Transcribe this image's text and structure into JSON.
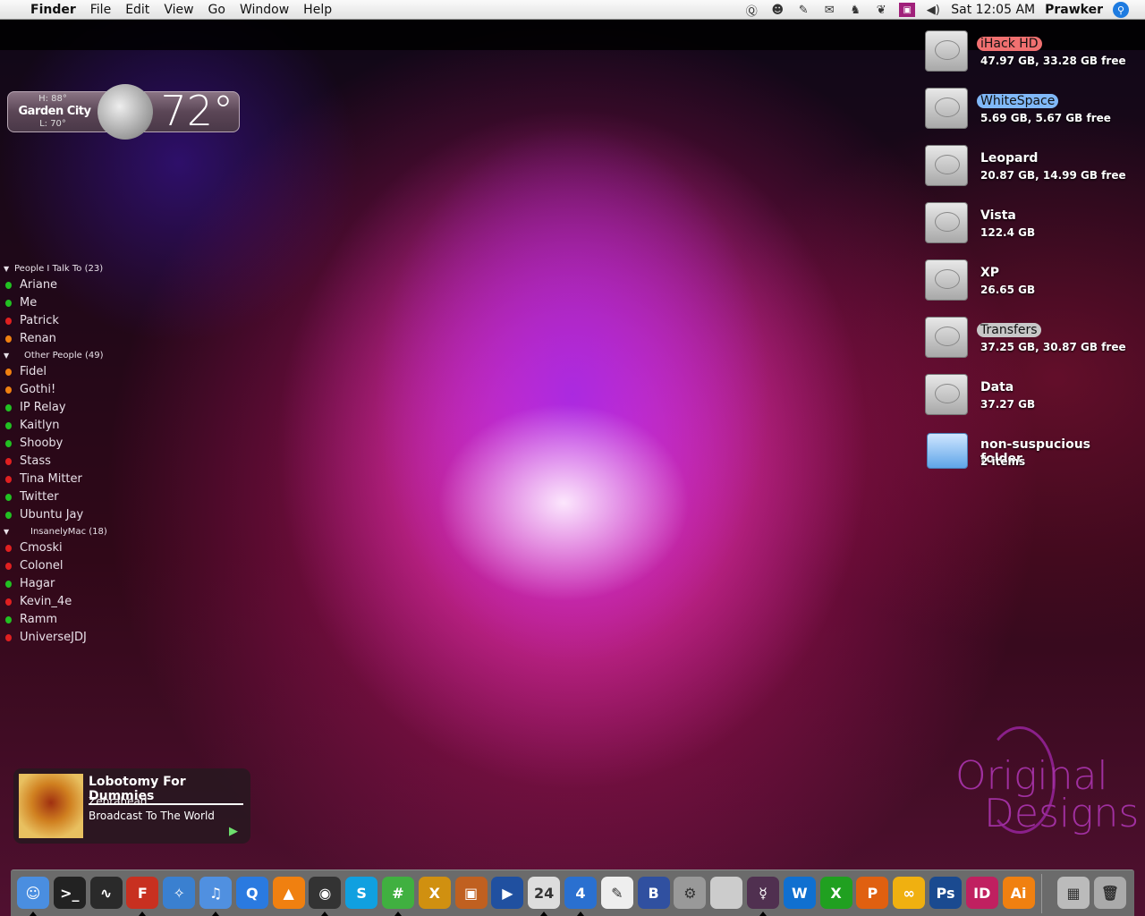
{
  "menubar": {
    "apple": "",
    "app": "Finder",
    "menus": [
      "File",
      "Edit",
      "View",
      "Go",
      "Window",
      "Help"
    ],
    "status_icons": [
      "quicksilver-icon",
      "adium-duck-icon",
      "growl-speech-icon",
      "mail-icon",
      "bird-icon",
      "paw-icon",
      "monitor-face-icon",
      "volume-icon"
    ],
    "clock": "Sat 12:05 AM",
    "user": "Prawker"
  },
  "weather": {
    "high": "H: 88°",
    "city": "Garden City",
    "low": "L: 70°",
    "temp": "72°"
  },
  "buddy_list": {
    "groups": [
      {
        "name": "People I Talk To (23)",
        "buddies": [
          {
            "name": "Ariane",
            "status": "green"
          },
          {
            "name": "Me ",
            "status": "green"
          },
          {
            "name": "Patrick",
            "status": "red"
          },
          {
            "name": "Renan",
            "status": "orange"
          }
        ]
      },
      {
        "name": "Other People (49)",
        "buddies": [
          {
            "name": "Fidel",
            "status": "orange"
          },
          {
            "name": "Gothi!",
            "status": "orange"
          },
          {
            "name": "IP Relay",
            "status": "green"
          },
          {
            "name": "Kaitlyn",
            "status": "green"
          },
          {
            "name": "Shooby",
            "status": "green"
          },
          {
            "name": "Stass",
            "status": "red"
          },
          {
            "name": "Tina Mitter",
            "status": "red"
          },
          {
            "name": "Twitter",
            "status": "green"
          },
          {
            "name": "Ubuntu Jay",
            "status": "green"
          }
        ]
      },
      {
        "name": "InsanelyMac (18)",
        "buddies": [
          {
            "name": "Cmoski",
            "status": "red"
          },
          {
            "name": "Colonel",
            "status": "red"
          },
          {
            "name": "Hagar",
            "status": "green"
          },
          {
            "name": "Kevin_4e",
            "status": "red"
          },
          {
            "name": "Ramm",
            "status": "green"
          },
          {
            "name": "UniverseJDJ",
            "status": "red"
          }
        ]
      }
    ],
    "status_colors": {
      "green": "#22c022",
      "red": "#e02020",
      "orange": "#f08010"
    }
  },
  "desktop": [
    {
      "name": "iHack HD",
      "info": "47.97 GB, 33.28 GB free",
      "label": "#f07070",
      "kind": "drive"
    },
    {
      "name": "WhiteSpace",
      "info": "5.69 GB, 5.67 GB free",
      "label": "#80b8f8",
      "kind": "drive"
    },
    {
      "name": "Leopard",
      "info": "20.87 GB, 14.99 GB free",
      "label": "",
      "kind": "drive"
    },
    {
      "name": "Vista",
      "info": "122.4 GB",
      "label": "",
      "kind": "drive"
    },
    {
      "name": "XP",
      "info": "26.65 GB",
      "label": "",
      "kind": "drive"
    },
    {
      "name": "Transfers",
      "info": "37.25 GB, 30.87 GB free",
      "label": "#c8c8c8",
      "kind": "drive"
    },
    {
      "name": "Data",
      "info": "37.27 GB",
      "label": "",
      "kind": "drive"
    },
    {
      "name": "non-suspucious folder",
      "info": "2 items",
      "label": "",
      "kind": "folder"
    }
  ],
  "now_playing": {
    "title": "Lobotomy For Dummies",
    "artist": "Zebrahead",
    "album": "Broadcast To The World"
  },
  "logo": {
    "text": "Original Designs"
  },
  "dock": [
    {
      "icon": "finder-icon",
      "color": "#4a8ee0",
      "glyph": "☺",
      "running": true
    },
    {
      "icon": "terminal-icon",
      "color": "#222",
      "glyph": ">_",
      "running": false
    },
    {
      "icon": "activity-monitor-icon",
      "color": "#2a2a2a",
      "glyph": "∿",
      "running": false
    },
    {
      "icon": "firefox-icon",
      "color": "#c83020",
      "glyph": "F",
      "running": true
    },
    {
      "icon": "safari-icon",
      "color": "#3a80d0",
      "glyph": "✧",
      "running": false
    },
    {
      "icon": "itunes-icon",
      "color": "#5090e0",
      "glyph": "♫",
      "running": true
    },
    {
      "icon": "quicktime-icon",
      "color": "#2a7ae0",
      "glyph": "Q",
      "running": false
    },
    {
      "icon": "vlc-icon",
      "color": "#f08010",
      "glyph": "▲",
      "running": false
    },
    {
      "icon": "adium-icon",
      "color": "#333",
      "glyph": "◉",
      "running": true
    },
    {
      "icon": "skype-icon",
      "color": "#10a0e0",
      "glyph": "S",
      "running": false
    },
    {
      "icon": "colloquy-icon",
      "color": "#40b040",
      "glyph": "#",
      "running": true
    },
    {
      "icon": "x11-icon",
      "color": "#d09010",
      "glyph": "X",
      "running": false
    },
    {
      "icon": "iphoto-icon",
      "color": "#c06020",
      "glyph": "▣",
      "running": false
    },
    {
      "icon": "imovie-icon",
      "color": "#2050a0",
      "glyph": "▶",
      "running": false
    },
    {
      "icon": "ical-icon",
      "color": "#ddd",
      "glyph": "24",
      "running": true
    },
    {
      "icon": "network-globe-icon",
      "color": "#2a70d0",
      "glyph": "4",
      "running": true
    },
    {
      "icon": "textedit-icon",
      "color": "#eee",
      "glyph": "✎",
      "running": false
    },
    {
      "icon": "bbedit-icon",
      "color": "#3050a0",
      "glyph": "B",
      "running": false
    },
    {
      "icon": "script-utility-icon",
      "color": "#999",
      "glyph": "⚙",
      "running": false
    },
    {
      "icon": "boot-camp-icon",
      "color": "#ccc",
      "glyph": "",
      "running": false
    },
    {
      "icon": "gender-app-icon",
      "color": "#503050",
      "glyph": "☿",
      "running": true
    },
    {
      "icon": "word-icon",
      "color": "#1070d0",
      "glyph": "W",
      "running": false
    },
    {
      "icon": "excel-icon",
      "color": "#20a020",
      "glyph": "X",
      "running": false
    },
    {
      "icon": "powerpoint-icon",
      "color": "#e06010",
      "glyph": "P",
      "running": false
    },
    {
      "icon": "entourage-icon",
      "color": "#f0b010",
      "glyph": "∞",
      "running": false
    },
    {
      "icon": "photoshop-icon",
      "color": "#1a4a90",
      "glyph": "Ps",
      "running": false
    },
    {
      "icon": "indesign-icon",
      "color": "#c02060",
      "glyph": "ID",
      "running": false
    },
    {
      "icon": "illustrator-icon",
      "color": "#f08010",
      "glyph": "Ai",
      "running": false
    },
    {
      "icon": "stacks-icon",
      "color": "#bbb",
      "glyph": "▦",
      "running": false
    },
    {
      "icon": "trash-icon",
      "color": "#aaa",
      "glyph": "🗑",
      "running": false
    }
  ]
}
